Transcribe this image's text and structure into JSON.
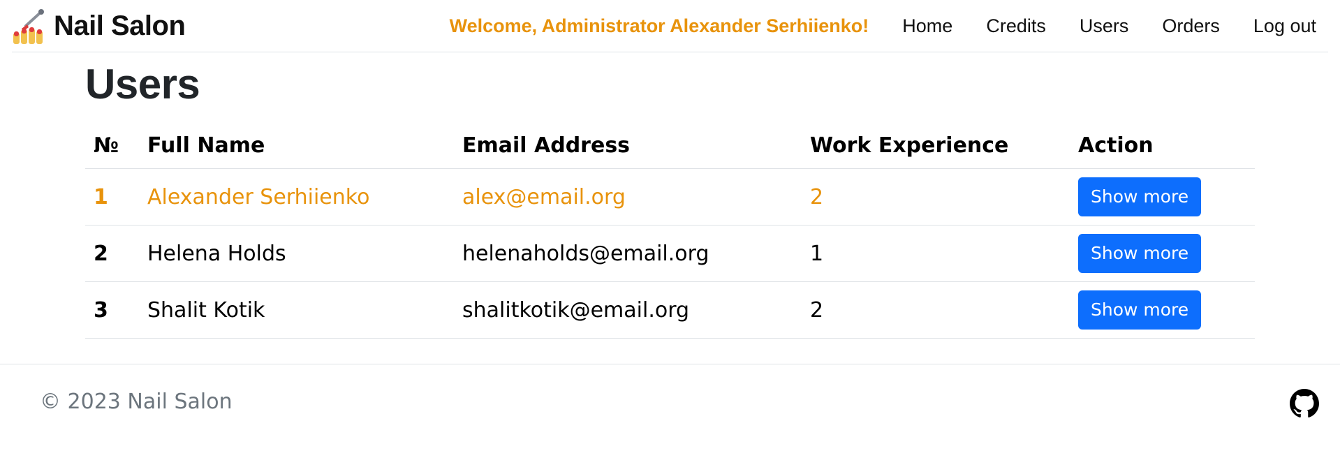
{
  "app": {
    "brand": "Nail Salon",
    "logo_icon": "nail-polish-icon"
  },
  "nav": {
    "welcome": "Welcome, Administrator Alexander Serhiienko!",
    "links": [
      "Home",
      "Credits",
      "Users",
      "Orders",
      "Log out"
    ]
  },
  "page": {
    "title": "Users"
  },
  "table": {
    "headers": [
      "№",
      "Full Name",
      "Email Address",
      "Work Experience",
      "Action"
    ],
    "rows": [
      {
        "num": "1",
        "name": "Alexander Serhiienko",
        "email": "alex@email.org",
        "experience": "2",
        "action": "Show more",
        "current_user": true
      },
      {
        "num": "2",
        "name": "Helena Holds",
        "email": "helenaholds@email.org",
        "experience": "1",
        "action": "Show more",
        "current_user": false
      },
      {
        "num": "3",
        "name": "Shalit Kotik",
        "email": "shalitkotik@email.org",
        "experience": "2",
        "action": "Show more",
        "current_user": false
      }
    ]
  },
  "footer": {
    "copyright": "© 2023 Nail Salon",
    "github_icon": "github-icon"
  },
  "colors": {
    "accent": "#e8930c",
    "button": "#0d6efd"
  }
}
